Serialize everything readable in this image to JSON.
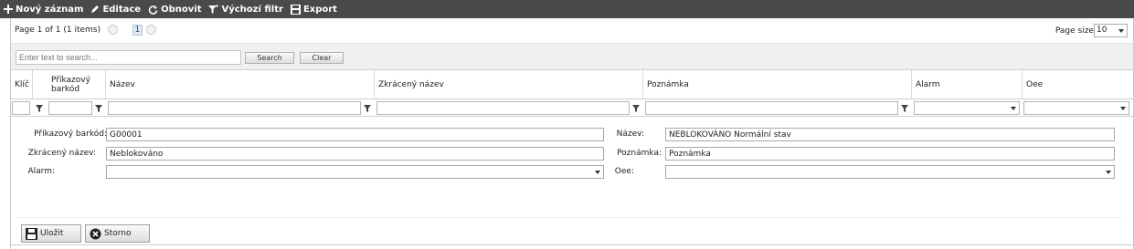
{
  "toolbar": {
    "new_label": "Nový záznam",
    "edit_label": "Editace",
    "refresh_label": "Obnovit",
    "default_filter_label": "Výchozí filtr",
    "export_label": "Export"
  },
  "pager": {
    "summary": "Page 1 of 1 (1 items)",
    "current_page": "1",
    "page_size_label": "Page size:",
    "page_size_value": "10"
  },
  "search": {
    "placeholder": "Enter text to search...",
    "search_button": "Search",
    "clear_button": "Clear"
  },
  "columns": [
    {
      "label": "Klíč"
    },
    {
      "label": "Příkazový barkód"
    },
    {
      "label": "Název"
    },
    {
      "label": "Zkrácený název"
    },
    {
      "label": "Poznámka"
    },
    {
      "label": "Alarm"
    },
    {
      "label": "Oee"
    }
  ],
  "form": {
    "barcode_label": "Příkazový barkód:",
    "barcode_value": "G00001",
    "name_label": "Název:",
    "name_value": "NEBLOKOVÁNO Normální stav",
    "short_name_label": "Zkrácený název:",
    "short_name_value": "Neblokováno",
    "note_label": "Poznámka:",
    "note_value": "Poznámka",
    "alarm_label": "Alarm:",
    "alarm_value": "",
    "oee_label": "Oee:",
    "oee_value": "",
    "save_button": "Uložit",
    "cancel_button": "Storno"
  },
  "colors": {
    "toolbar_bg": "#4a4a4a",
    "accent": "#1e4e8c"
  }
}
